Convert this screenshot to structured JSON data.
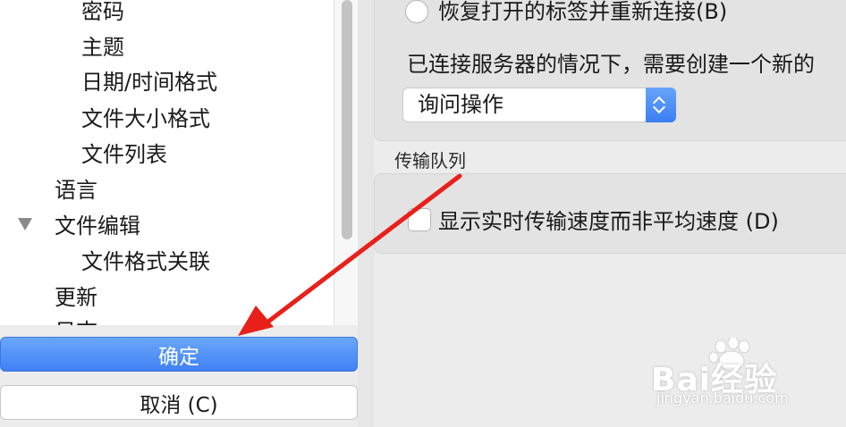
{
  "sidebar": {
    "items": [
      {
        "label": "密码"
      },
      {
        "label": "主题"
      },
      {
        "label": "日期/时间格式"
      },
      {
        "label": "文件大小格式"
      },
      {
        "label": "文件列表"
      },
      {
        "label": "语言"
      },
      {
        "label": "文件编辑"
      },
      {
        "label": "文件格式关联"
      },
      {
        "label": "更新"
      },
      {
        "label": "日志"
      }
    ]
  },
  "buttons": {
    "ok_label": "确定",
    "cancel_label": "取消 (C)"
  },
  "connection": {
    "restore_radio_label": "恢复打开的标签并重新连接(B)",
    "new_connection_text": "已连接服务器的情况下，需要创建一个新的",
    "action_select_value": "询问操作"
  },
  "transfer_queue": {
    "group_label": "传输队列",
    "speed_checkbox_label": "显示实时传输速度而非平均速度 (D)"
  },
  "watermark": {
    "brand": "Bai经验",
    "url": "jingyan.baidu.com"
  },
  "colors": {
    "accent": "#3f82f5",
    "annotation_arrow": "#e8201a"
  }
}
